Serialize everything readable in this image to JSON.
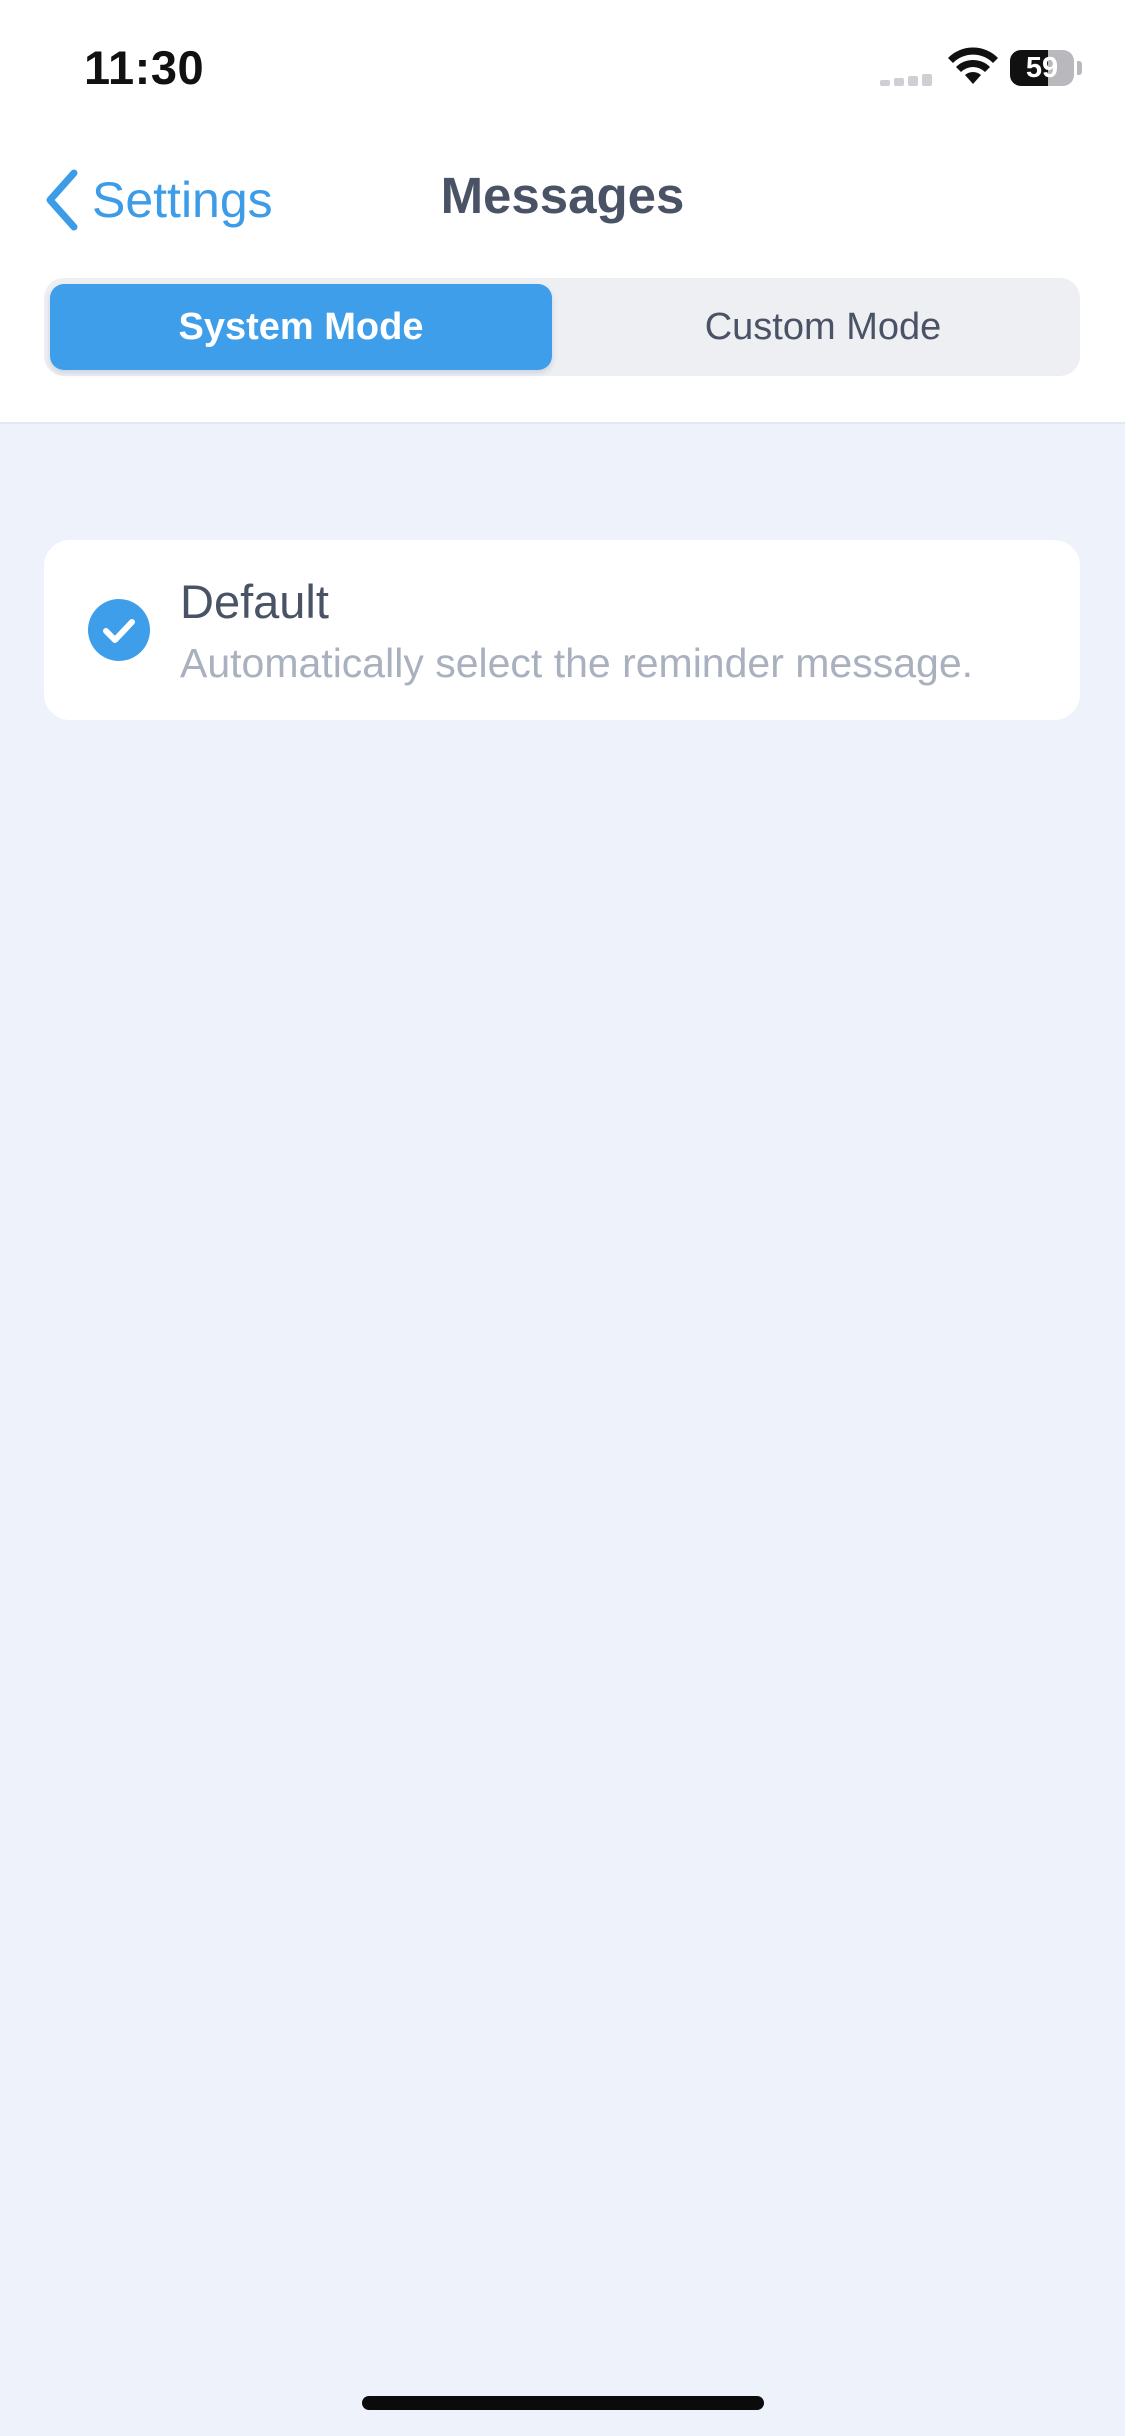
{
  "status_bar": {
    "time": "11:30",
    "battery": "59",
    "battery_level_percent": 59,
    "signal_icon": "cellular-signal-icon",
    "wifi_icon": "wifi-icon"
  },
  "nav": {
    "back_label": "Settings",
    "back_icon": "chevron-left-icon",
    "title": "Messages"
  },
  "segmented": {
    "selected": "System Mode",
    "options": [
      "System Mode",
      "Custom Mode"
    ]
  },
  "options": [
    {
      "title": "Default",
      "description": "Automatically select the reminder message.",
      "selected": true,
      "icon": "checkmark-circle-icon"
    }
  ],
  "colors": {
    "accent": "#3e9ee9",
    "background": "#eef3fb",
    "text": "#4a5366",
    "secondary_text": "#a9b0be"
  }
}
